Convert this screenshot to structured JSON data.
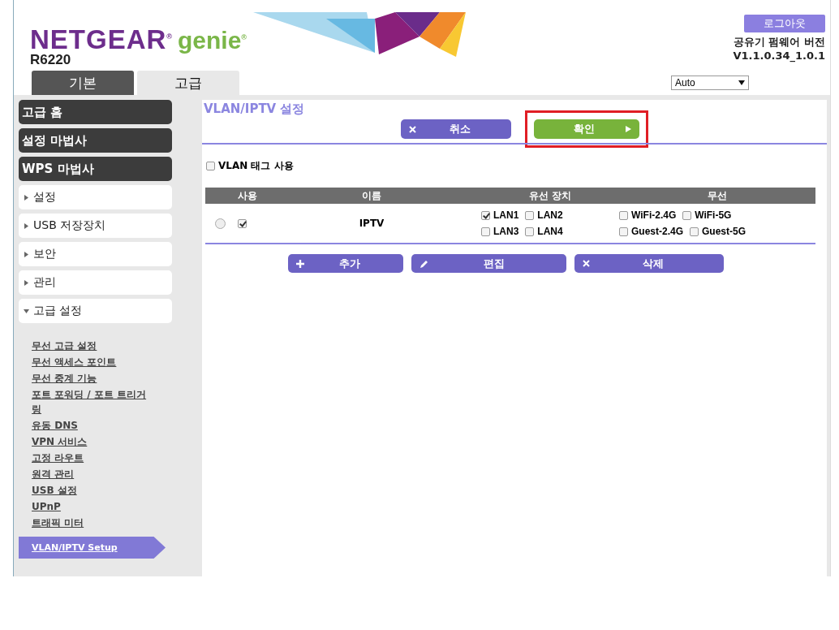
{
  "header": {
    "brand": "NETGEAR$^{®}$",
    "product": "genie$^{®}$",
    "model": "R6220",
    "logout": "로그아웃",
    "firmware_label": "공유기 펌웨어 버전",
    "firmware_version": "V1.1.0.34_1.0.1"
  },
  "tabs": [
    {
      "label": "기본",
      "selected": false
    },
    {
      "label": "고급",
      "selected": true
    }
  ],
  "language_select": {
    "value": "Auto"
  },
  "sidebar": {
    "items": [
      {
        "label": "고급 홈",
        "kind": "dark"
      },
      {
        "label": "설정 마법사",
        "kind": "dark"
      },
      {
        "label": "WPS 마법사",
        "kind": "dark"
      },
      {
        "label": "설정",
        "kind": "folder",
        "expanded": false
      },
      {
        "label": "USB 저장장치",
        "kind": "folder",
        "expanded": false
      },
      {
        "label": "보안",
        "kind": "folder",
        "expanded": false
      },
      {
        "label": "관리",
        "kind": "folder",
        "expanded": false
      },
      {
        "label": "고급 설정",
        "kind": "folder",
        "expanded": true,
        "children": [
          {
            "label": "무선 고급 설정",
            "selected": false
          },
          {
            "label": "무선 액세스 포인트",
            "selected": false
          },
          {
            "label": "무선 중계 기능",
            "selected": false
          },
          {
            "label": "포트 포워딩 / 포트 트리거링",
            "selected": false
          },
          {
            "label": "유동 DNS",
            "selected": false
          },
          {
            "label": "VPN 서비스",
            "selected": false
          },
          {
            "label": "고정 라우트",
            "selected": false
          },
          {
            "label": "원격 관리",
            "selected": false
          },
          {
            "label": "USB 설정",
            "selected": false
          },
          {
            "label": "UPnP",
            "selected": false
          },
          {
            "label": "트래픽 미터",
            "selected": false
          },
          {
            "label": "VLAN/IPTV Setup",
            "selected": true
          }
        ]
      }
    ]
  },
  "page": {
    "title": "VLAN/IPTV 설정",
    "buttons": [
      {
        "label": "취소",
        "kind": "cancel",
        "highlighted": false
      },
      {
        "label": "확인",
        "kind": "apply",
        "highlighted": true
      }
    ],
    "vlan_tag": {
      "label": "VLAN 태그 사용",
      "checked": false
    },
    "table": {
      "columns": [
        "사용",
        "이름",
        "유선 장치",
        "무선"
      ],
      "rows": [
        {
          "selected": false,
          "enabled": true,
          "name": "IPTV",
          "wired": [
            {
              "label": "LAN1",
              "checked": true
            },
            {
              "label": "LAN2",
              "checked": false
            },
            {
              "label": "LAN3",
              "checked": false
            },
            {
              "label": "LAN4",
              "checked": false
            }
          ],
          "wireless": [
            {
              "label": "WiFi-2.4G",
              "checked": false
            },
            {
              "label": "WiFi-5G",
              "checked": false
            },
            {
              "label": "Guest-2.4G",
              "checked": false
            },
            {
              "label": "Guest-5G",
              "checked": false
            }
          ]
        }
      ]
    },
    "actions": [
      {
        "label": "추가",
        "kind": "add"
      },
      {
        "label": "편집",
        "kind": "edit"
      },
      {
        "label": "삭제",
        "kind": "delete"
      }
    ]
  }
}
